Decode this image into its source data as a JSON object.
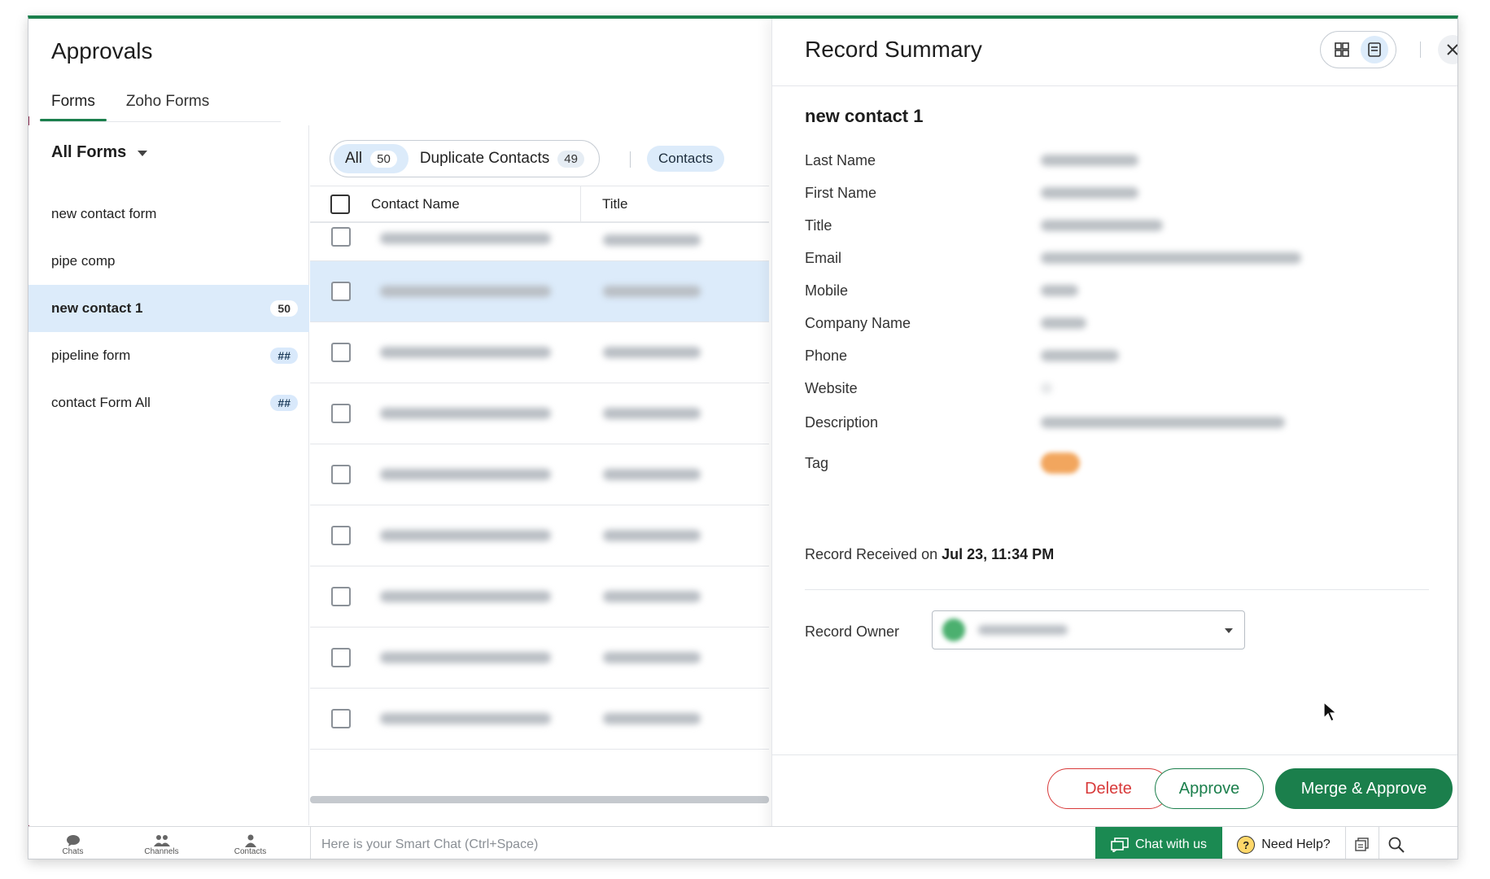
{
  "page": {
    "title": "Approvals",
    "tabs": [
      {
        "label": "Forms",
        "active": true
      },
      {
        "label": "Zoho Forms",
        "active": false
      }
    ]
  },
  "sidebar": {
    "heading": "All Forms",
    "items": [
      {
        "label": "new contact form",
        "badge": ""
      },
      {
        "label": "pipe comp",
        "badge": ""
      },
      {
        "label": "new contact 1",
        "badge": "50",
        "active": true
      },
      {
        "label": "pipeline form",
        "badge": "##"
      },
      {
        "label": "contact Form All",
        "badge": "##"
      }
    ]
  },
  "list": {
    "filters": [
      {
        "label": "All",
        "count": "50",
        "active": true
      },
      {
        "label": "Duplicate Contacts",
        "count": "49",
        "active": false
      }
    ],
    "module_chip": "Contacts",
    "columns": {
      "name": "Contact Name",
      "title": "Title"
    },
    "row_count": 9,
    "selected_row": 1
  },
  "panel": {
    "title": "Record Summary",
    "record_name": "new contact 1",
    "fields": [
      {
        "label": "Last Name"
      },
      {
        "label": "First Name"
      },
      {
        "label": "Title"
      },
      {
        "label": "Email"
      },
      {
        "label": "Mobile"
      },
      {
        "label": "Company Name"
      },
      {
        "label": "Phone"
      },
      {
        "label": "Website"
      },
      {
        "label": "Description"
      },
      {
        "label": "Tag"
      }
    ],
    "received_prefix": "Record Received on",
    "received_date": "Jul 23, 11:34 PM",
    "owner_label": "Record Owner",
    "buttons": {
      "delete": "Delete",
      "approve": "Approve",
      "merge": "Merge & Approve"
    }
  },
  "bottombar": {
    "nav": [
      {
        "label": "Chats",
        "icon": "chat-icon"
      },
      {
        "label": "Channels",
        "icon": "channels-icon"
      },
      {
        "label": "Contacts",
        "icon": "contacts-icon"
      }
    ],
    "smartchat_placeholder": "Here is your Smart Chat (Ctrl+Space)",
    "chat_with_us": "Chat with us",
    "need_help": "Need Help?"
  },
  "colors": {
    "accent_green": "#1b7f4c",
    "selected_blue": "#dcebfa",
    "delete_red": "#d83a3a"
  }
}
